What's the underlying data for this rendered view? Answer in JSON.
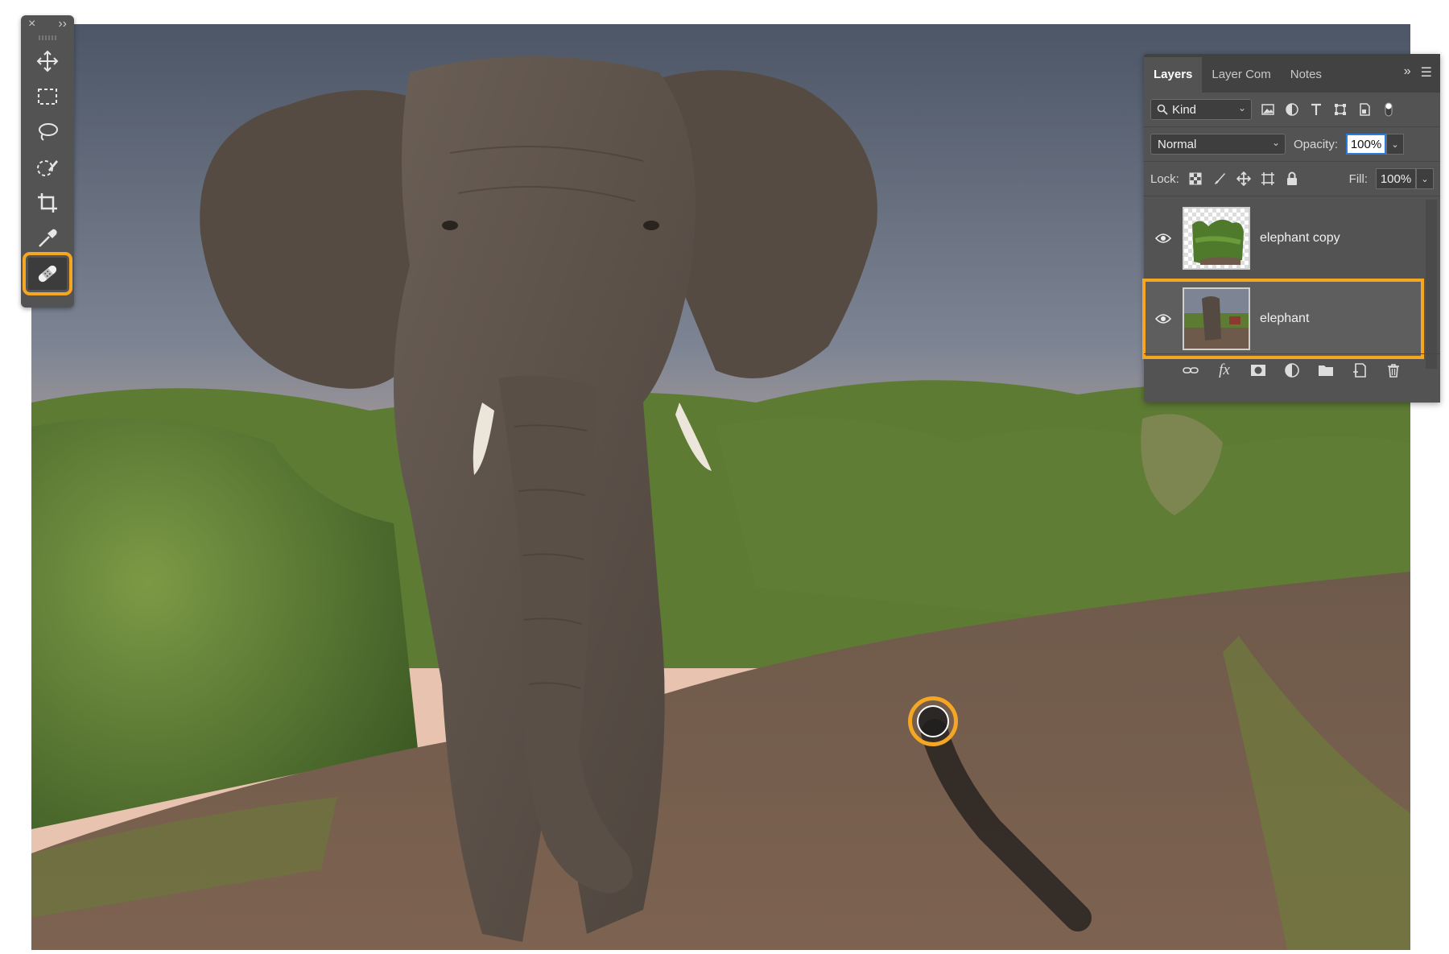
{
  "toolbar": {
    "close_glyph": "×",
    "collapse_glyph": "››",
    "tools": [
      {
        "name": "move-tool",
        "icon": "move-icon"
      },
      {
        "name": "marquee-tool",
        "icon": "rectangle-marquee-icon"
      },
      {
        "name": "lasso-tool",
        "icon": "lasso-icon"
      },
      {
        "name": "quick-selection-tool",
        "icon": "quick-selection-icon"
      },
      {
        "name": "crop-tool",
        "icon": "crop-icon"
      },
      {
        "name": "eyedropper-tool",
        "icon": "eyedropper-icon"
      },
      {
        "name": "healing-brush-tool",
        "icon": "bandage-icon",
        "selected": true
      }
    ],
    "highlight_color": "#f5a623"
  },
  "layers_panel": {
    "tabs": [
      {
        "label": "Layers",
        "active": true
      },
      {
        "label": "Layer Com",
        "active": false
      },
      {
        "label": "Notes",
        "active": false
      }
    ],
    "filter": {
      "label": "Kind"
    },
    "blend_mode": "Normal",
    "opacity_label": "Opacity:",
    "opacity_value": "100%",
    "lock_label": "Lock:",
    "fill_label": "Fill:",
    "fill_value": "100%",
    "layers": [
      {
        "name": "elephant copy",
        "visible": true,
        "selected": false
      },
      {
        "name": "elephant",
        "visible": true,
        "selected": true
      }
    ],
    "bottom_icons": [
      "link-icon",
      "fx-icon",
      "mask-icon",
      "adjustment-icon",
      "folder-icon",
      "new-layer-icon",
      "trash-icon"
    ],
    "fx_label": "fx"
  },
  "canvas": {
    "cursor": "healing-brush-cursor",
    "accent": "#f5a623"
  }
}
